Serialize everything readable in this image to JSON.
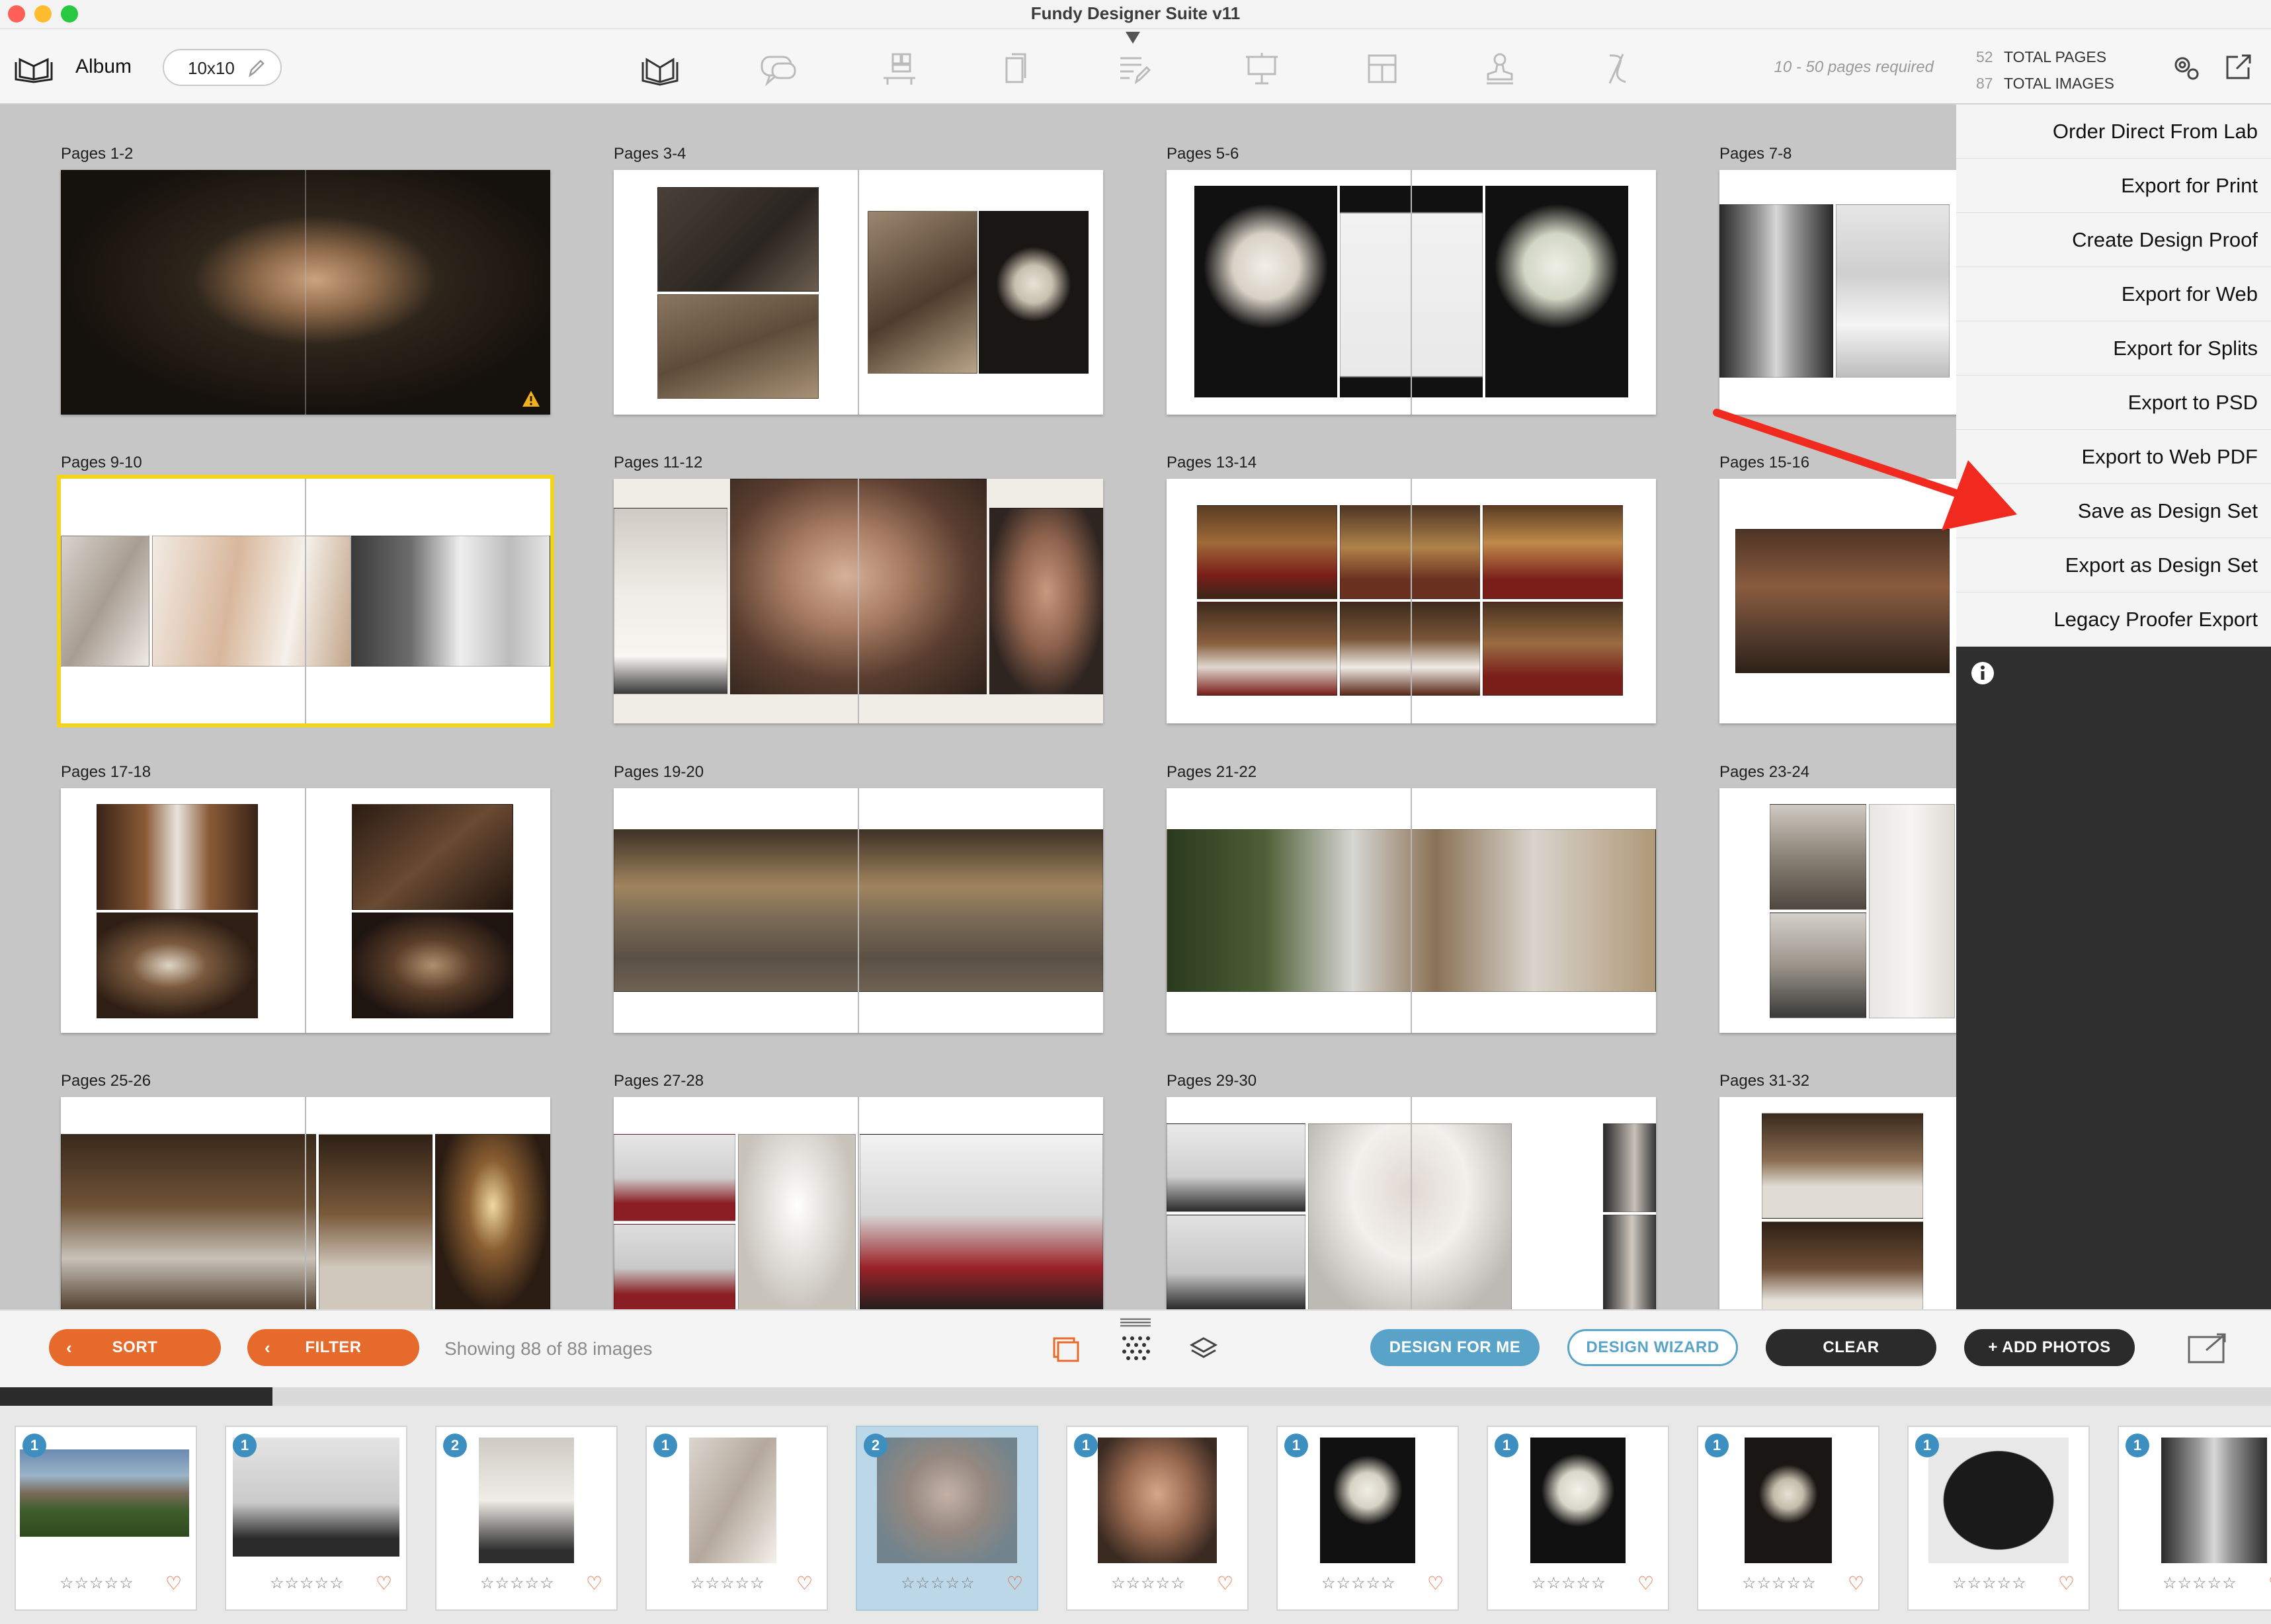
{
  "window": {
    "title": "Fundy Designer Suite v11"
  },
  "toolbar": {
    "album_label": "Album",
    "album_size": "10x10",
    "pages_required": "10 - 50 pages required",
    "total_pages_count": "52",
    "total_pages_label": "TOTAL PAGES",
    "total_images_count": "87",
    "total_images_label": "TOTAL IMAGES",
    "tools": [
      {
        "icon": "album-designer-icon",
        "active": true
      },
      {
        "icon": "proofing-chat-icon",
        "active": false
      },
      {
        "icon": "wall-display-icon",
        "active": false
      },
      {
        "icon": "card-layers-icon",
        "active": false
      },
      {
        "icon": "list-edit-icon",
        "active": false
      },
      {
        "icon": "presentation-icon",
        "active": false
      },
      {
        "icon": "layout-grid-icon",
        "active": false
      },
      {
        "icon": "stamp-icon",
        "active": false
      },
      {
        "icon": "curve-tool-icon",
        "active": false
      }
    ]
  },
  "spreads": [
    {
      "label": "Pages 1-2"
    },
    {
      "label": "Pages 3-4"
    },
    {
      "label": "Pages 5-6"
    },
    {
      "label": "Pages 7-8"
    },
    {
      "label": "Pages 9-10"
    },
    {
      "label": "Pages 11-12"
    },
    {
      "label": "Pages 13-14"
    },
    {
      "label": "Pages 15-16"
    },
    {
      "label": "Pages 17-18"
    },
    {
      "label": "Pages 19-20"
    },
    {
      "label": "Pages 21-22"
    },
    {
      "label": "Pages 23-24"
    },
    {
      "label": "Pages 25-26"
    },
    {
      "label": "Pages 27-28"
    },
    {
      "label": "Pages 29-30"
    },
    {
      "label": "Pages 31-32"
    }
  ],
  "export_menu": {
    "items": [
      "Order Direct From Lab",
      "Export for Print",
      "Create Design Proof",
      "Export for Web",
      "Export for Splits",
      "Export to PSD",
      "Export to Web PDF",
      "Save as Design Set",
      "Export as Design Set",
      "Legacy Proofer Export"
    ],
    "highlighted_item": "Save as Design Set"
  },
  "bottom_bar": {
    "sort_label": "SORT",
    "filter_label": "FILTER",
    "showing_text": "Showing 88 of 88 images",
    "design_for_me_label": "DESIGN FOR ME",
    "design_wizard_label": "DESIGN WIZARD",
    "clear_label": "CLEAR",
    "add_photos_label": "+ ADD PHOTOS"
  },
  "filmstrip": {
    "scroll_progress": 0.12,
    "thumbs": [
      {
        "badge": "1",
        "stars": "☆☆☆☆☆",
        "heart": "♡"
      },
      {
        "badge": "1",
        "stars": "☆☆☆☆☆",
        "heart": "♡"
      },
      {
        "badge": "2",
        "stars": "☆☆☆☆☆",
        "heart": "♡"
      },
      {
        "badge": "1",
        "stars": "☆☆☆☆☆",
        "heart": "♡"
      },
      {
        "badge": "2",
        "stars": "☆☆☆☆☆",
        "heart": "♡",
        "selected": true
      },
      {
        "badge": "1",
        "stars": "☆☆☆☆☆",
        "heart": "♡"
      },
      {
        "badge": "1",
        "stars": "☆☆☆☆☆",
        "heart": "♡"
      },
      {
        "badge": "1",
        "stars": "☆☆☆☆☆",
        "heart": "♡"
      },
      {
        "badge": "1",
        "stars": "☆☆☆☆☆",
        "heart": "♡"
      },
      {
        "badge": "1",
        "stars": "☆☆☆☆☆",
        "heart": "♡"
      },
      {
        "badge": "1",
        "stars": "☆☆☆☆☆",
        "heart": "♡"
      }
    ]
  },
  "colors": {
    "accent_orange": "#e66a2c",
    "accent_blue": "#5aa3c8",
    "selection_yellow": "#f3d51e",
    "arrow_red": "#f02a1e"
  }
}
